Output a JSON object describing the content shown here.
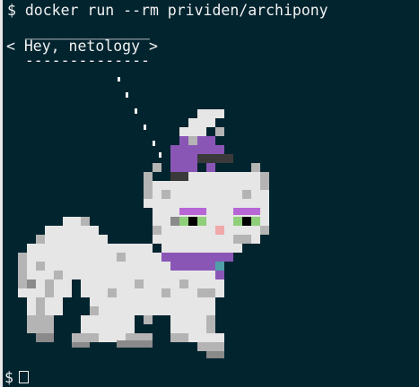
{
  "terminal": {
    "command_line": "$ docker run --rm prividen/archipony",
    "bubble_top": "  ______________",
    "bubble_text": "< Hey, netology >",
    "bubble_bottom": "  --------------",
    "prompt": "$"
  },
  "colors": {
    "background": "#02242f",
    "text": "#f2f2f2",
    "fur_light": "#e6e6e6",
    "fur_shadow": "#b4b4b4",
    "fur_dark": "#8a8a8a",
    "purple": "#8a56b6",
    "eyeshadow": "#b766d6",
    "eye_green": "#8fcf7a",
    "nose_pink": "#f0a8a8",
    "bell_teal": "#4f9fa8",
    "hat_dark": "#3a3a3a"
  },
  "art": {
    "icon": "pixel-cat-pony-icon"
  }
}
